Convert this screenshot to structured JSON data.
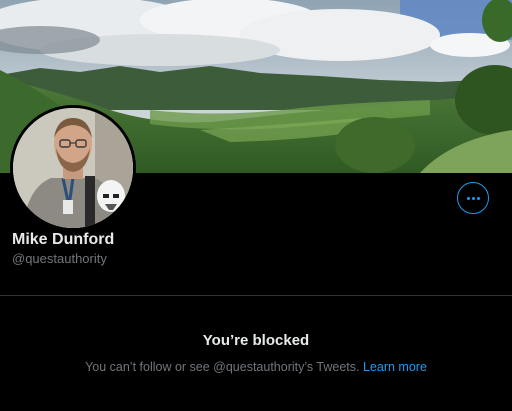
{
  "profile": {
    "display_name": "Mike Dunford",
    "handle": "@questauthority",
    "banner_image": "mountain-valley-landscape",
    "avatar_image": "profile-photo"
  },
  "actions": {
    "more_icon": "more-options-icon"
  },
  "blocked": {
    "title": "You’re blocked",
    "message": "You can’t follow or see @questauthority’s Tweets. ",
    "link_label": "Learn more"
  },
  "colors": {
    "background": "#000000",
    "accent": "#1d9bf0",
    "primary_text": "#e7e9ea",
    "secondary_text": "#71767b",
    "divider": "#2f3336"
  }
}
